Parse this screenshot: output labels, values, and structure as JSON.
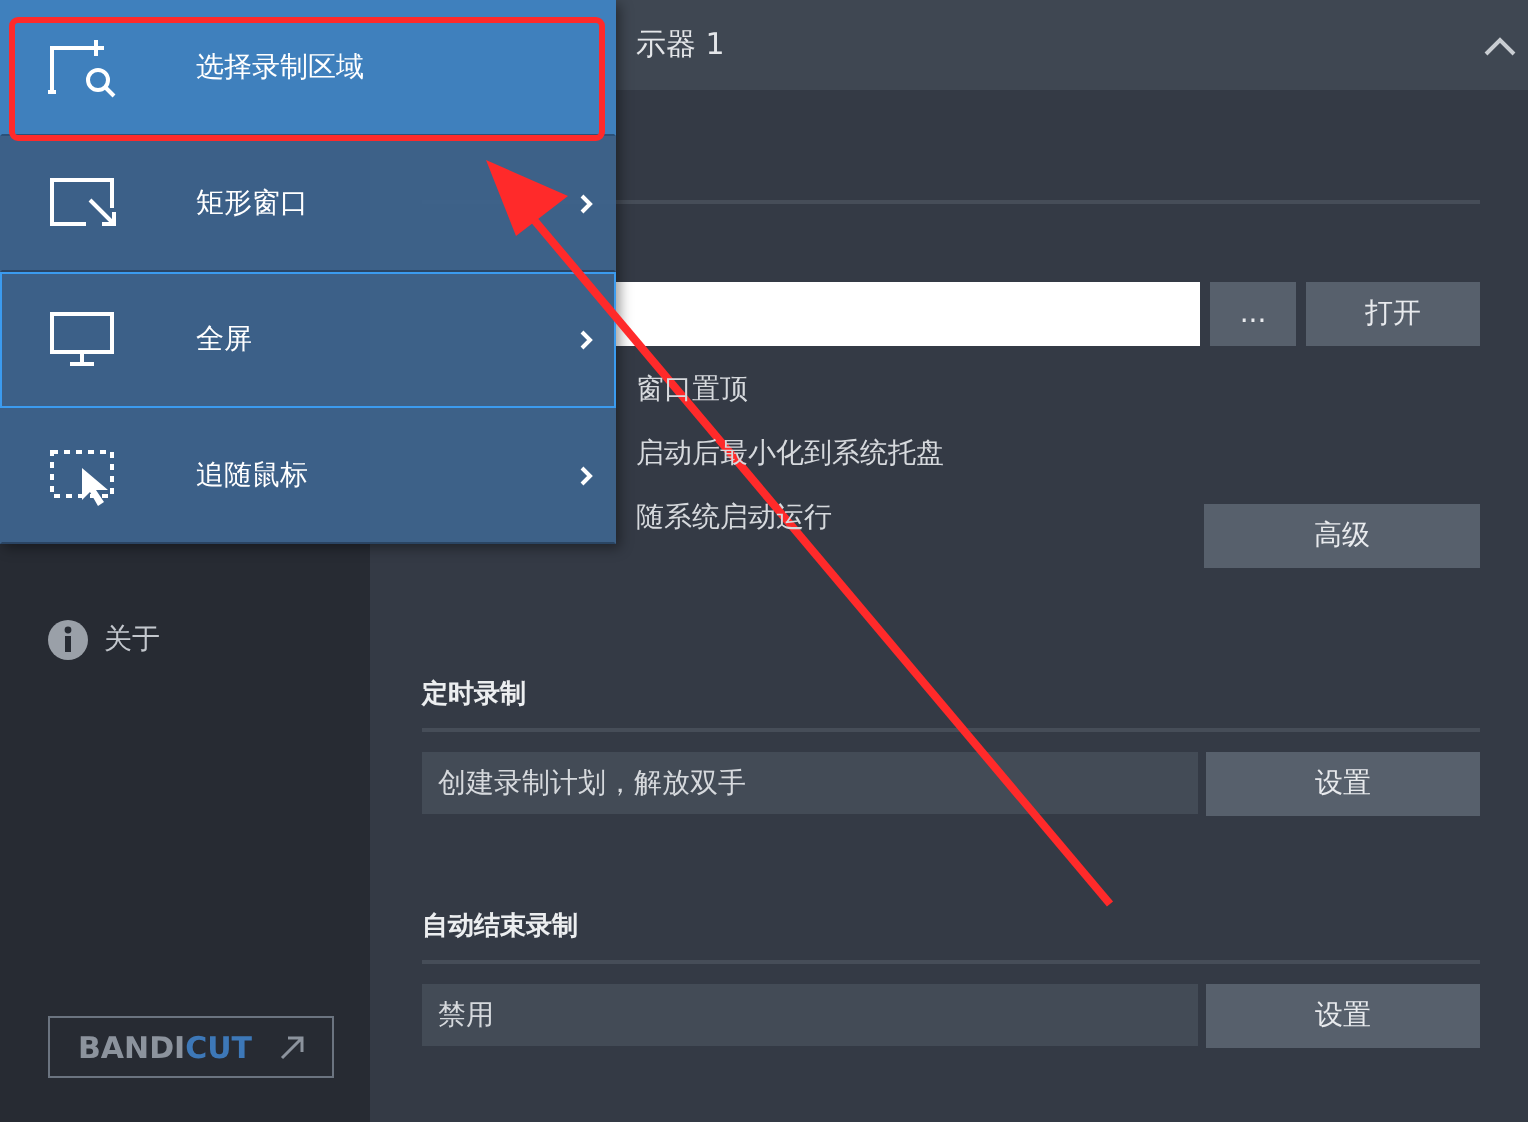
{
  "header": {
    "title": "示器 1"
  },
  "sidebar": {
    "items": [
      {
        "label": "关于"
      }
    ],
    "promo": {
      "label_main": "BANDI",
      "label_accent": "CUT"
    }
  },
  "output": {
    "browse_button": "...",
    "open_button": "打开"
  },
  "options": [
    {
      "label": "窗口置顶"
    },
    {
      "label": "启动后最小化到系统托盘"
    },
    {
      "label": "随系统启动运行"
    }
  ],
  "advanced_button": "高级",
  "sections": [
    {
      "title": "定时录制",
      "value": "创建录制计划，解放双手",
      "button": "设置"
    },
    {
      "title": "自动结束录制",
      "value": "禁用",
      "button": "设置"
    }
  ],
  "menu": {
    "items": [
      {
        "label": "选择录制区域",
        "selected": true,
        "focused": false,
        "submenu": false
      },
      {
        "label": "矩形窗口",
        "selected": false,
        "focused": false,
        "submenu": true
      },
      {
        "label": "全屏",
        "selected": false,
        "focused": true,
        "submenu": true
      },
      {
        "label": "追随鼠标",
        "selected": false,
        "focused": false,
        "submenu": true
      }
    ]
  }
}
